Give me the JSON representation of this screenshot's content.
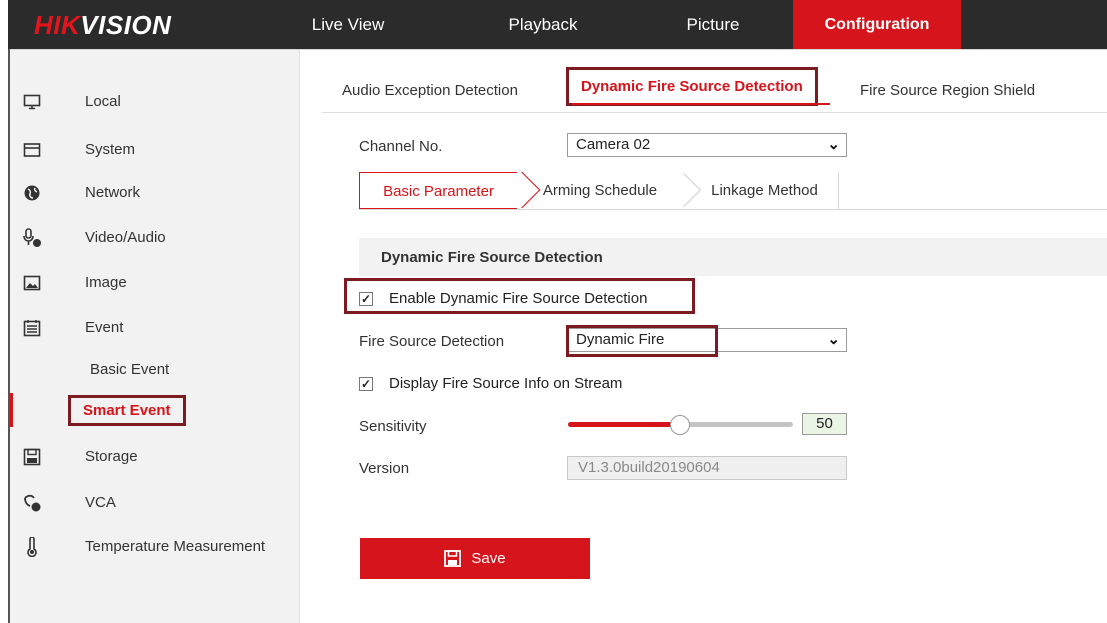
{
  "brand": {
    "logo_part1": "HIK",
    "logo_part2": "VISION"
  },
  "topnav": {
    "items": [
      {
        "label": "Live View"
      },
      {
        "label": "Playback"
      },
      {
        "label": "Picture"
      },
      {
        "label": "Configuration"
      }
    ],
    "active": "Configuration"
  },
  "sidebar": {
    "items": [
      {
        "label": "Local",
        "icon": "monitor-icon"
      },
      {
        "label": "System",
        "icon": "system-icon"
      },
      {
        "label": "Network",
        "icon": "globe-icon"
      },
      {
        "label": "Video/Audio",
        "icon": "video-audio-icon"
      },
      {
        "label": "Image",
        "icon": "image-icon"
      },
      {
        "label": "Event",
        "icon": "calendar-icon"
      },
      {
        "label": "Storage",
        "icon": "storage-icon"
      },
      {
        "label": "VCA",
        "icon": "vca-icon"
      },
      {
        "label": "Temperature Measurement",
        "icon": "thermometer-icon"
      }
    ],
    "event_sub": [
      {
        "label": "Basic Event"
      },
      {
        "label": "Smart Event"
      }
    ],
    "active_sub": "Smart Event"
  },
  "subtabs": [
    {
      "label": "Audio Exception Detection"
    },
    {
      "label": "Dynamic Fire Source Detection"
    },
    {
      "label": "Fire Source Region Shield"
    }
  ],
  "channel": {
    "label": "Channel No.",
    "value": "Camera 02"
  },
  "innertabs": [
    {
      "label": "Basic Parameter"
    },
    {
      "label": "Arming Schedule"
    },
    {
      "label": "Linkage Method"
    }
  ],
  "section": {
    "title": "Dynamic Fire Source Detection"
  },
  "form": {
    "enable_label": "Enable Dynamic Fire Source Detection",
    "enable_checked": true,
    "fire_detection_label": "Fire Source Detection",
    "fire_detection_value": "Dynamic Fire",
    "display_info_label": "Display Fire Source Info on Stream",
    "display_info_checked": true,
    "sensitivity_label": "Sensitivity",
    "sensitivity_value": "50",
    "version_label": "Version",
    "version_value": "V1.3.0build20190604"
  },
  "save": {
    "label": "Save"
  },
  "colors": {
    "accent": "#d6141b",
    "highlight_border": "#7c1c22",
    "topbar": "#2b2b2b"
  }
}
